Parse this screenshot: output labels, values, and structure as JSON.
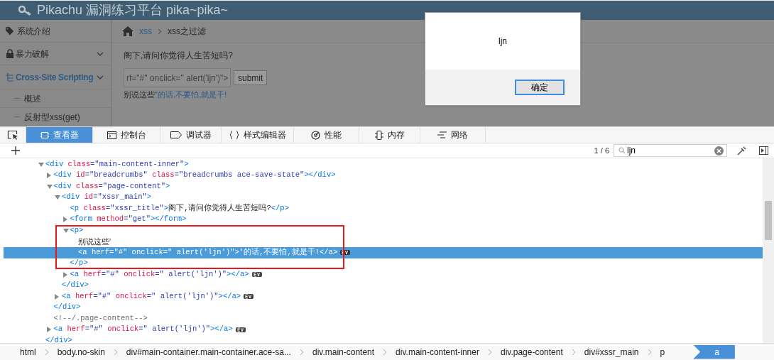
{
  "page": {
    "header_title": "Pikachu 漏洞练习平台 pika~pika~",
    "sidebar": [
      {
        "label": "系统介绍",
        "selected": false,
        "expandable": false
      },
      {
        "label": "暴力破解",
        "selected": false,
        "expandable": true
      },
      {
        "label": "Cross-Site Scripting",
        "selected": true,
        "expandable": true,
        "children": [
          {
            "label": "概述"
          },
          {
            "label": "反射型xss(get)"
          }
        ]
      }
    ],
    "breadcrumb": [
      "xss",
      "xss之过滤"
    ],
    "question": "阁下,请问你觉得人生苦短吗?",
    "input_value": "rf=\"#\" onclick=\" alert('ljn')\">",
    "submit": "submit",
    "result_text": "别说这些'",
    "result_link": "'的话,不要怕,就是干!"
  },
  "alert": {
    "message": "ljn",
    "button": "确定"
  },
  "devtools": {
    "tabs": [
      {
        "label": "查看器",
        "selected": true
      },
      {
        "label": "控制台",
        "selected": false
      },
      {
        "label": "调试器",
        "selected": false
      },
      {
        "label": "样式编辑器",
        "selected": false
      },
      {
        "label": "性能",
        "selected": false
      },
      {
        "label": "内存",
        "selected": false
      },
      {
        "label": "网络",
        "selected": false
      }
    ],
    "search": {
      "count": "1 / 6",
      "value": "ljn"
    },
    "tree": [
      {
        "kind": "element",
        "selected": false,
        "ev": false,
        "expanded": true,
        "line": [
          {
            "kind": "tag",
            "text": "<div"
          },
          {
            "kind": "attr",
            "text": " class"
          },
          {
            "kind": "value",
            "text": "=\"main-content-inner\""
          },
          {
            "kind": "tag",
            "text": ">"
          }
        ],
        "close": [
          {
            "kind": "tag",
            "text": "</div>"
          }
        ],
        "children": [
          {
            "kind": "element",
            "selected": false,
            "ev": false,
            "expanded": false,
            "line": [
              {
                "kind": "tag",
                "text": "<div"
              },
              {
                "kind": "attr",
                "text": " id"
              },
              {
                "kind": "value",
                "text": "=\"breadcrumbs\""
              },
              {
                "kind": "attr",
                "text": " class"
              },
              {
                "kind": "value",
                "text": "=\"breadcrumbs ace-save-state\""
              },
              {
                "kind": "tag",
                "text": "></div>"
              }
            ]
          },
          {
            "kind": "element",
            "selected": false,
            "ev": false,
            "expanded": true,
            "line": [
              {
                "kind": "tag",
                "text": "<div"
              },
              {
                "kind": "attr",
                "text": " class"
              },
              {
                "kind": "value",
                "text": "=\"page-content\""
              },
              {
                "kind": "tag",
                "text": ">"
              }
            ],
            "close": [
              {
                "kind": "tag",
                "text": "</div>"
              }
            ],
            "children": [
              {
                "kind": "element",
                "selected": false,
                "ev": false,
                "expanded": true,
                "line": [
                  {
                    "kind": "tag",
                    "text": "<div"
                  },
                  {
                    "kind": "attr",
                    "text": " id"
                  },
                  {
                    "kind": "value",
                    "text": "=\"xssr_main\""
                  },
                  {
                    "kind": "tag",
                    "text": ">"
                  }
                ],
                "close": [
                  {
                    "kind": "tag",
                    "text": "</div>"
                  }
                ],
                "children": [
                  {
                    "kind": "element",
                    "selected": false,
                    "ev": false,
                    "line": [
                      {
                        "kind": "tag",
                        "text": "<p"
                      },
                      {
                        "kind": "attr",
                        "text": " class"
                      },
                      {
                        "kind": "value",
                        "text": "=\"xssr_title\""
                      },
                      {
                        "kind": "tag",
                        "text": ">"
                      },
                      {
                        "kind": "text",
                        "text": "阁下,请问你觉得人生苦短吗?"
                      },
                      {
                        "kind": "tag",
                        "text": "</p>"
                      }
                    ]
                  },
                  {
                    "kind": "element",
                    "selected": false,
                    "ev": false,
                    "expanded": false,
                    "line": [
                      {
                        "kind": "tag",
                        "text": "<form"
                      },
                      {
                        "kind": "attr",
                        "text": " method"
                      },
                      {
                        "kind": "value",
                        "text": "=\"get\""
                      },
                      {
                        "kind": "tag",
                        "text": "></form>"
                      }
                    ]
                  },
                  {
                    "kind": "element",
                    "selected": false,
                    "ev": false,
                    "expanded": true,
                    "line": [
                      {
                        "kind": "tag",
                        "text": "<p>"
                      }
                    ],
                    "close": [
                      {
                        "kind": "tag",
                        "text": "</p>"
                      }
                    ],
                    "children": [
                      {
                        "kind": "text",
                        "text": "别说这些'"
                      },
                      {
                        "kind": "element",
                        "selected": true,
                        "ev": true,
                        "line": [
                          {
                            "text": "<a herf=\"#\" onclick=\" alert('ljn')\">'的话,不要怕,就是干!</a>"
                          }
                        ]
                      }
                    ]
                  },
                  {
                    "kind": "element",
                    "selected": false,
                    "ev": true,
                    "expanded": false,
                    "line": [
                      {
                        "kind": "tag",
                        "text": "<a"
                      },
                      {
                        "kind": "attr",
                        "text": " herf"
                      },
                      {
                        "kind": "value",
                        "text": "=\"#\""
                      },
                      {
                        "kind": "attr",
                        "text": " onclick"
                      },
                      {
                        "kind": "value",
                        "text": "=\" alert('ljn')\""
                      },
                      {
                        "kind": "tag",
                        "text": "></a>"
                      }
                    ]
                  }
                ]
              },
              {
                "kind": "element",
                "selected": false,
                "ev": true,
                "expanded": false,
                "line": [
                  {
                    "kind": "tag",
                    "text": "<a"
                  },
                  {
                    "kind": "attr",
                    "text": " herf"
                  },
                  {
                    "kind": "value",
                    "text": "=\"#\""
                  },
                  {
                    "kind": "attr",
                    "text": " onclick"
                  },
                  {
                    "kind": "value",
                    "text": "=\" alert('ljn')\""
                  },
                  {
                    "kind": "tag",
                    "text": "></a>"
                  }
                ]
              }
            ]
          },
          {
            "kind": "comment",
            "text": "<!--/.page-content-->"
          },
          {
            "kind": "element",
            "selected": false,
            "ev": true,
            "expanded": false,
            "line": [
              {
                "kind": "tag",
                "text": "<a"
              },
              {
                "kind": "attr",
                "text": " herf"
              },
              {
                "kind": "value",
                "text": "=\"#\""
              },
              {
                "kind": "attr",
                "text": " onclick"
              },
              {
                "kind": "value",
                "text": "=\" alert('ljn')\""
              },
              {
                "kind": "tag",
                "text": "></a>"
              }
            ]
          }
        ]
      }
    ],
    "breadcrumbs": [
      {
        "label": "html",
        "selected": false
      },
      {
        "label": "body.no-skin",
        "selected": false
      },
      {
        "label": "div#main-container.main-container.ace-sa...",
        "selected": false
      },
      {
        "label": "div.main-content",
        "selected": false
      },
      {
        "label": "div.main-content-inner",
        "selected": false
      },
      {
        "label": "div.page-content",
        "selected": false
      },
      {
        "label": "div#xssr_main",
        "selected": false
      },
      {
        "label": "p",
        "selected": false
      },
      {
        "label": "a",
        "selected": true
      }
    ]
  }
}
